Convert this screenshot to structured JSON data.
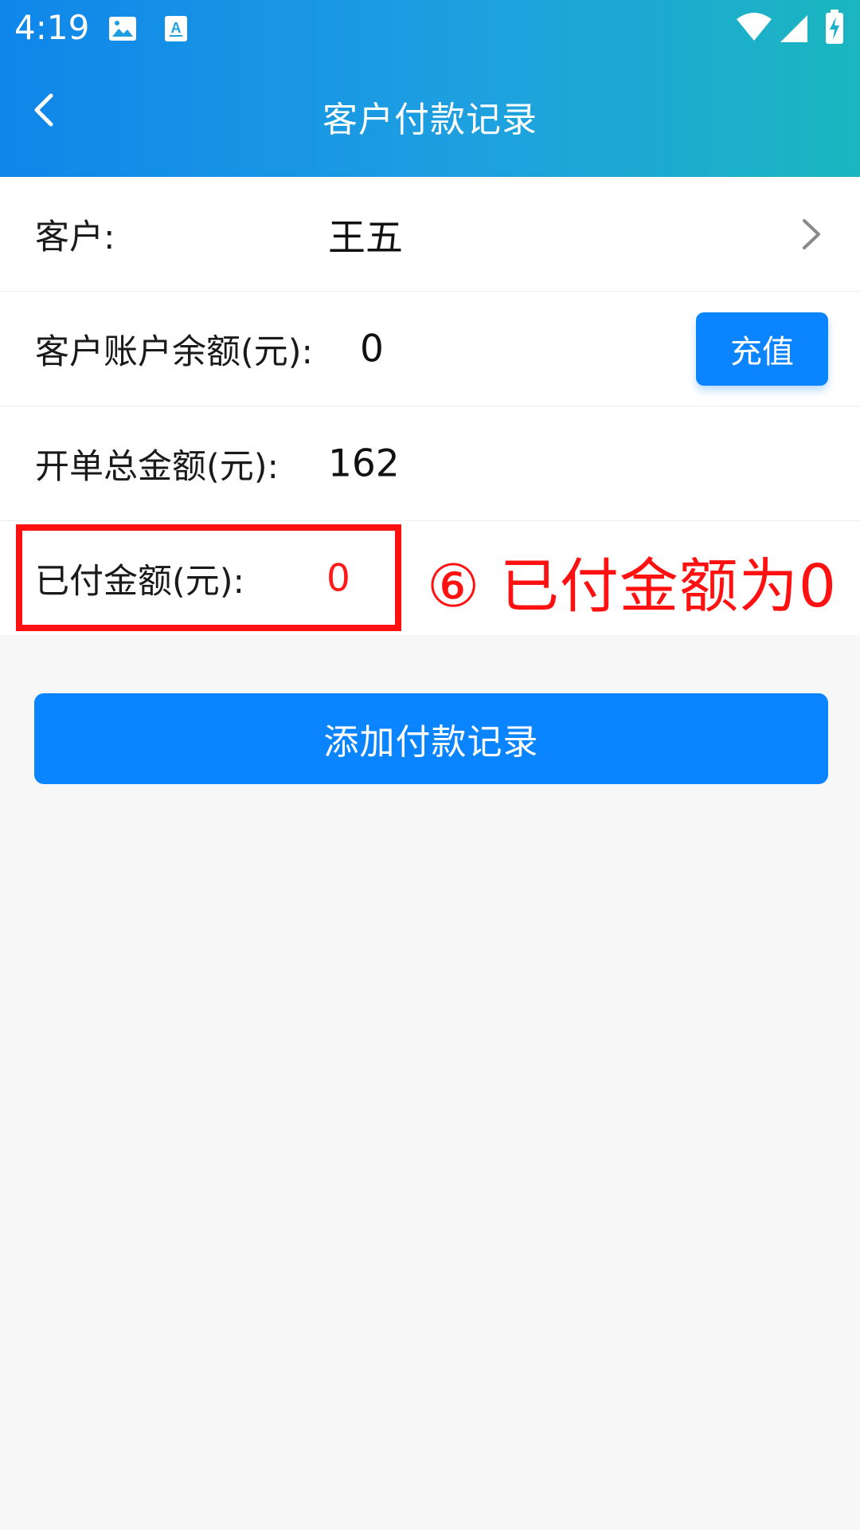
{
  "status_bar": {
    "time": "4:19",
    "icons": [
      "image-icon",
      "a-letter-icon",
      "wifi-icon",
      "signal-icon",
      "battery-charging-icon"
    ]
  },
  "navbar": {
    "title": "客户付款记录",
    "back_icon": "chevron-left-icon"
  },
  "rows": [
    {
      "label": "客户:",
      "value": "王五"
    },
    {
      "label": "客户账户余额(元):",
      "value": "0",
      "action": "充值"
    },
    {
      "label": "开单总金额(元):",
      "value": "162"
    },
    {
      "label": "已付金额(元):",
      "value": "0"
    }
  ],
  "annotation": {
    "text": "⑥ 已付金额为0",
    "color": "#ff1111"
  },
  "add_button": {
    "label": "添加付款记录"
  },
  "colors": {
    "accent": "#0a84ff",
    "header_start": "#0f86ea",
    "header_end": "#1bb6c0",
    "highlight": "#ff1111"
  }
}
